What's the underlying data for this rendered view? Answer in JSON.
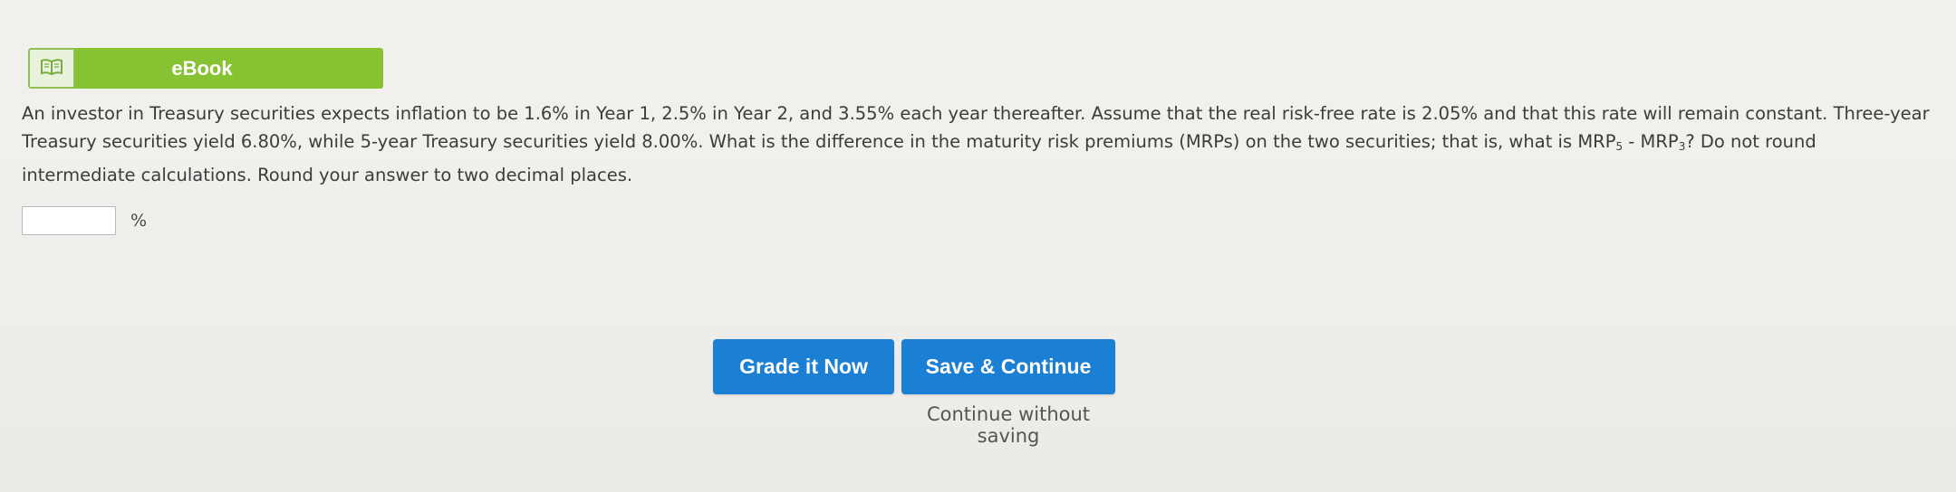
{
  "ebook": {
    "label": "eBook",
    "icon": "book-icon"
  },
  "question": {
    "part1": "An investor in Treasury securities expects inflation to be 1.6% in Year 1, 2.5% in Year 2, and 3.55% each year thereafter. Assume that the real risk-free rate is 2.05% and that this rate will remain constant. Three-year Treasury securities yield 6.80%, while 5-year Treasury securities yield 8.00%. What is the difference in the maturity risk premiums (MRPs) on the two securities; that is, what is ",
    "mrp5_base": "MRP",
    "mrp5_sub": "5",
    "minus": " - ",
    "mrp3_base": "MRP",
    "mrp3_sub": "3",
    "part2": "? Do not round intermediate calculations. Round your answer to two decimal places."
  },
  "answer": {
    "value": "",
    "placeholder": "",
    "unit": "%"
  },
  "buttons": {
    "grade": "Grade it Now",
    "save": "Save & Continue",
    "continue": "Continue without saving"
  },
  "colors": {
    "ebook_green": "#86c232",
    "button_blue": "#1b7fd3"
  }
}
